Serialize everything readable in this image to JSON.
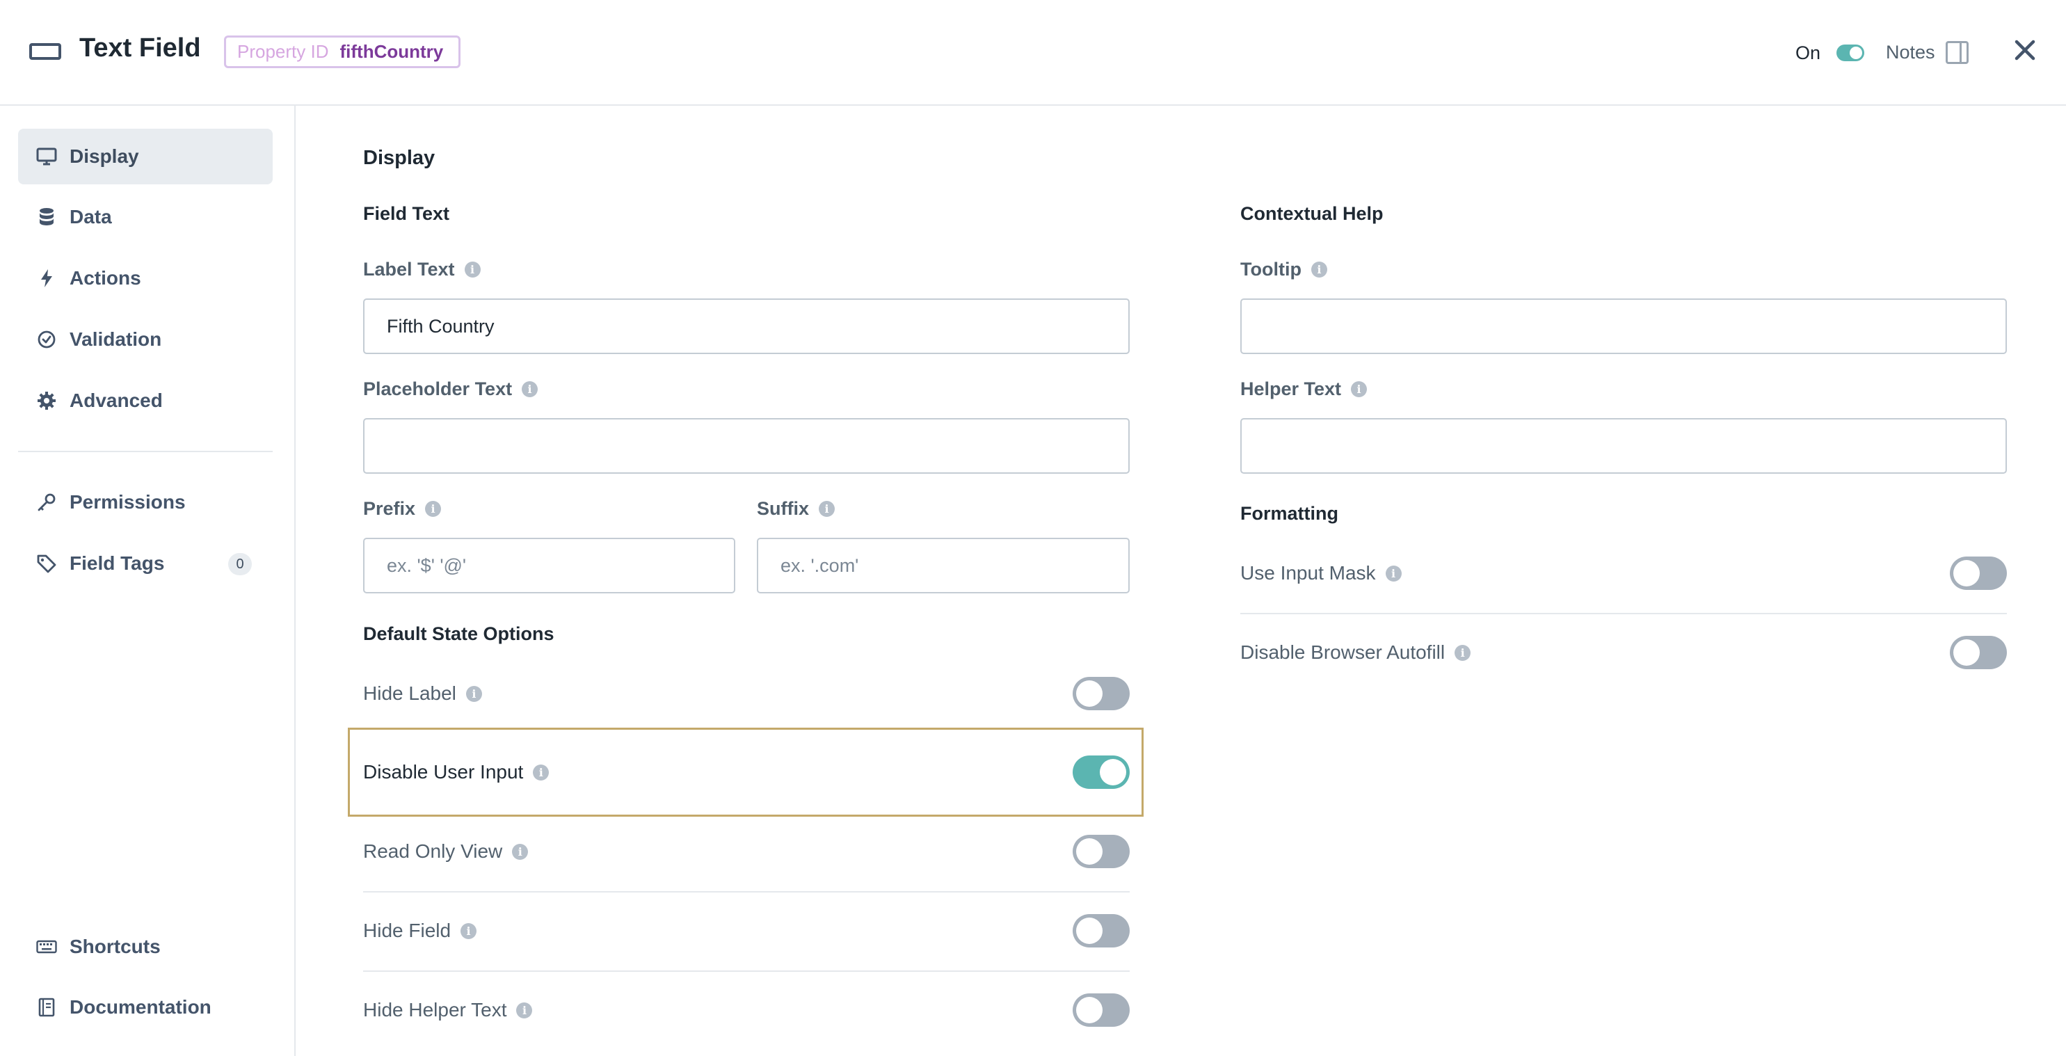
{
  "header": {
    "title": "Text Field",
    "property_id_label": "Property ID",
    "property_id_value": "fifthCountry",
    "on_label": "On",
    "notes_label": "Notes",
    "icons": [
      "text-field-icon",
      "notes-panel-icon",
      "close-icon"
    ]
  },
  "sidebar": {
    "items": [
      {
        "label": "Display",
        "icon": "monitor-icon",
        "active": true
      },
      {
        "label": "Data",
        "icon": "database-icon"
      },
      {
        "label": "Actions",
        "icon": "bolt-icon"
      },
      {
        "label": "Validation",
        "icon": "check-circle-icon"
      },
      {
        "label": "Advanced",
        "icon": "gear-icon"
      },
      {
        "label": "Permissions",
        "icon": "key-icon"
      },
      {
        "label": "Field Tags",
        "icon": "tag-icon",
        "count": "0"
      },
      {
        "label": "Shortcuts",
        "icon": "keyboard-icon"
      },
      {
        "label": "Documentation",
        "icon": "book-icon"
      }
    ]
  },
  "main": {
    "title": "Display",
    "field_text": {
      "title": "Field Text",
      "label_text": {
        "label": "Label Text",
        "value": "Fifth Country"
      },
      "placeholder_text": {
        "label": "Placeholder Text",
        "value": ""
      },
      "prefix": {
        "label": "Prefix",
        "placeholder": "ex. '$' '@'"
      },
      "suffix": {
        "label": "Suffix",
        "placeholder": "ex. '.com'"
      }
    },
    "default_state": {
      "title": "Default State Options",
      "options": [
        {
          "label": "Hide Label",
          "on": false
        },
        {
          "label": "Disable User Input",
          "on": true
        },
        {
          "label": "Read Only View",
          "on": false
        },
        {
          "label": "Hide Field",
          "on": false
        },
        {
          "label": "Hide Helper Text",
          "on": false
        }
      ]
    },
    "contextual_help": {
      "title": "Contextual Help",
      "tooltip": {
        "label": "Tooltip",
        "value": ""
      },
      "helper_text": {
        "label": "Helper Text",
        "value": ""
      }
    },
    "formatting": {
      "title": "Formatting",
      "options": [
        {
          "label": "Use Input Mask",
          "on": false
        },
        {
          "label": "Disable Browser Autofill",
          "on": false
        }
      ]
    }
  },
  "colors": {
    "accent_teal": "#5bb5b1",
    "highlight_border": "#c4a96a",
    "property_id_purple": "#7c3a9a"
  }
}
